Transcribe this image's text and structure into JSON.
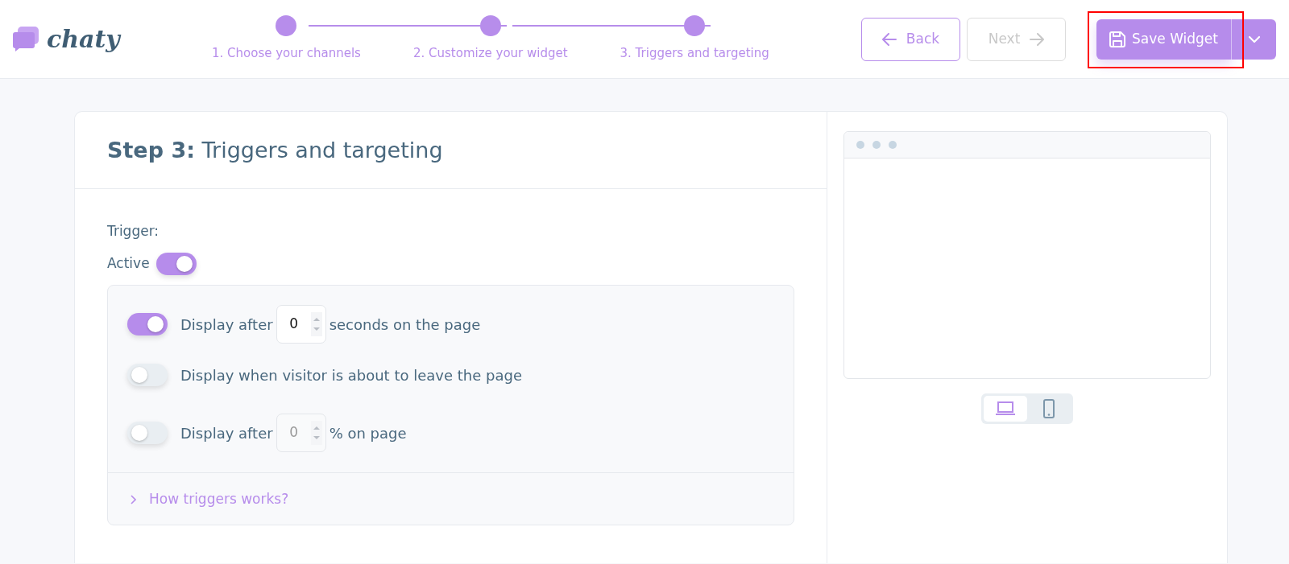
{
  "logo": {
    "text": "chaty"
  },
  "steps": [
    {
      "label": "1. Choose your channels"
    },
    {
      "label": "2. Customize your widget"
    },
    {
      "label": "3. Triggers and targeting"
    }
  ],
  "nav_buttons": [
    {
      "kind": "back",
      "label": "Back",
      "disabled": false
    },
    {
      "kind": "next",
      "label": "Next",
      "disabled": true
    }
  ],
  "save_button": {
    "label": "Save Widget",
    "highlighted": true
  },
  "section": {
    "title": "**Step 3:** Triggers and targeting"
  },
  "trigger": {
    "label": "Trigger:",
    "active_label": "Active",
    "on": true
  },
  "rules": [
    {
      "kind": "number",
      "on": true,
      "before": "Display after",
      "value": "0",
      "after": "seconds on the page",
      "disabled": false
    },
    {
      "kind": "plain",
      "on": false,
      "text": "Display when visitor is about to leave the page"
    },
    {
      "kind": "number",
      "on": false,
      "before": "Display after",
      "value": "0",
      "after": "% on page",
      "disabled": true
    }
  ],
  "help_link": "How triggers works?",
  "preview": {
    "devices": [
      {
        "kind": "desktop",
        "selected": true
      },
      {
        "kind": "mobile",
        "selected": false
      }
    ]
  }
}
